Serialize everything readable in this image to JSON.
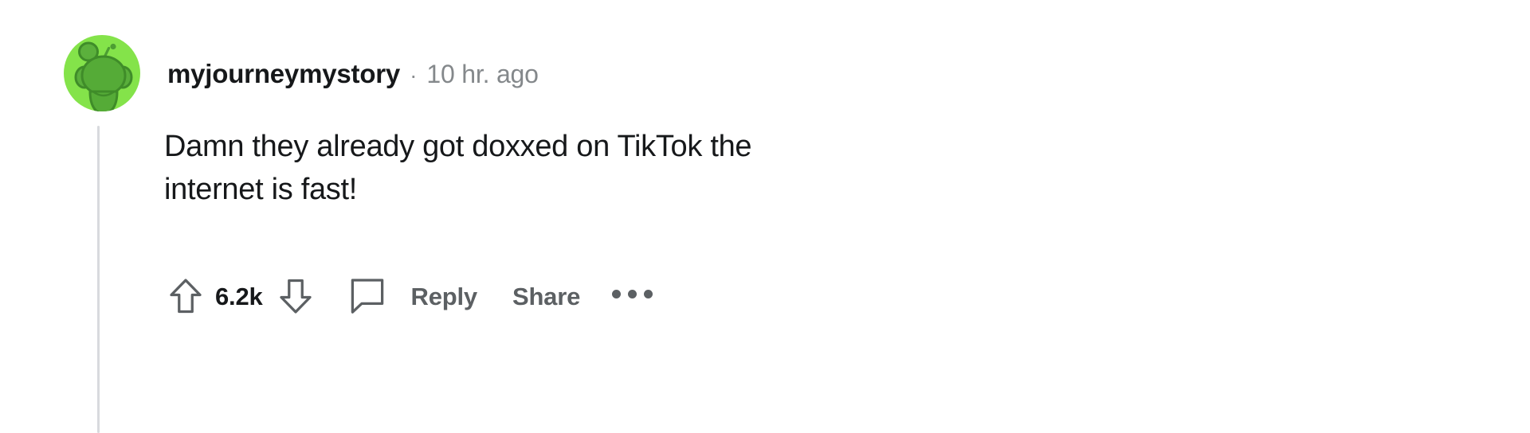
{
  "comment": {
    "author": {
      "username": "myjourneymystory",
      "avatar_icon": "reddit-snoo-avatar",
      "avatar_bg_color": "#84e34a",
      "avatar_fg_color": "#4a9e2e"
    },
    "separator": "·",
    "timestamp": "10 hr. ago",
    "body_lines": [
      "Damn they already got doxxed on TikTok the",
      "internet is fast!"
    ],
    "body_text": "Damn they already got doxxed on TikTok the internet is fast!",
    "actions": {
      "upvote_icon": "arrow-up-icon",
      "vote_count": "6.2k",
      "downvote_icon": "arrow-down-icon",
      "comment_icon": "comment-bubble-icon",
      "reply_label": "Reply",
      "share_label": "Share",
      "overflow_icon": "ellipsis-icon"
    },
    "colors": {
      "text": "#16181a",
      "muted": "#84888b",
      "action": "#5c6063",
      "thread_line": "#d8dade",
      "background": "#ffffff"
    }
  }
}
